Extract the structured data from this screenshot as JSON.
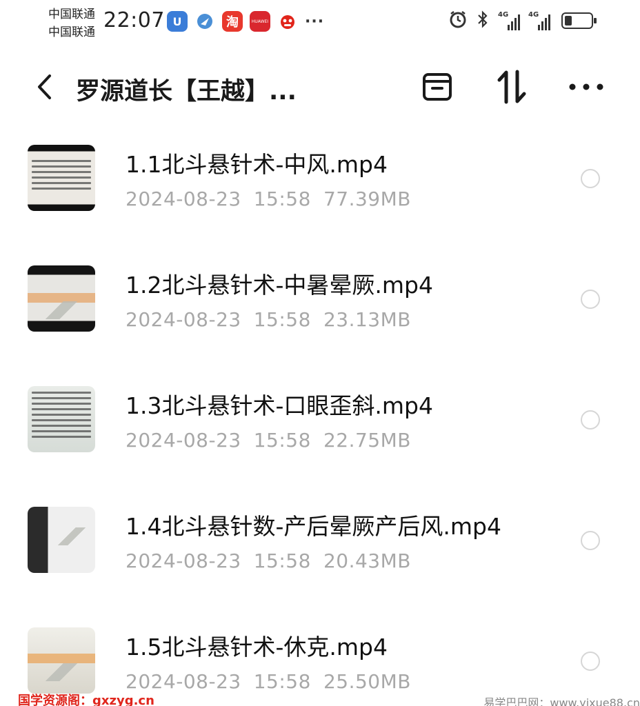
{
  "status_bar": {
    "carriers": [
      "中国联通",
      "中国联通"
    ],
    "time": "22:07",
    "apps": [
      {
        "icon": "u-app-icon",
        "glyph": "U"
      },
      {
        "icon": "feather-app-icon",
        "glyph": "✦"
      },
      {
        "icon": "taobao-icon",
        "glyph": "淘"
      },
      {
        "icon": "huawei-icon",
        "glyph": "HUAWEI"
      },
      {
        "icon": "jd-icon",
        "glyph": ""
      }
    ],
    "more_glyph": "···",
    "sim1_label": "4G",
    "sim2_label": "4G"
  },
  "toolbar": {
    "title": "罗源道长【王越】..."
  },
  "files": [
    {
      "name": "1.1北斗悬针术-中风.mp4",
      "date": "2024-08-23",
      "time": "15:58",
      "size": "77.39MB"
    },
    {
      "name": "1.2北斗悬针术-中暑晕厥.mp4",
      "date": "2024-08-23",
      "time": "15:58",
      "size": "23.13MB"
    },
    {
      "name": "1.3北斗悬针术-口眼歪斜.mp4",
      "date": "2024-08-23",
      "time": "15:58",
      "size": "22.75MB"
    },
    {
      "name": "1.4北斗悬针数-产后晕厥产后风.mp4",
      "date": "2024-08-23",
      "time": "15:58",
      "size": "20.43MB"
    },
    {
      "name": "1.5北斗悬针术-休克.mp4",
      "date": "2024-08-23",
      "time": "15:58",
      "size": "25.50MB"
    }
  ],
  "watermarks": {
    "left": "国学资源阁：gxzyg.cn",
    "right": "易学巴巴网：www.yixue88.cn"
  },
  "colors": {
    "meta_text": "#a8a8a8",
    "radio_border": "#d6d6d6",
    "watermark_red": "#e0261d"
  }
}
